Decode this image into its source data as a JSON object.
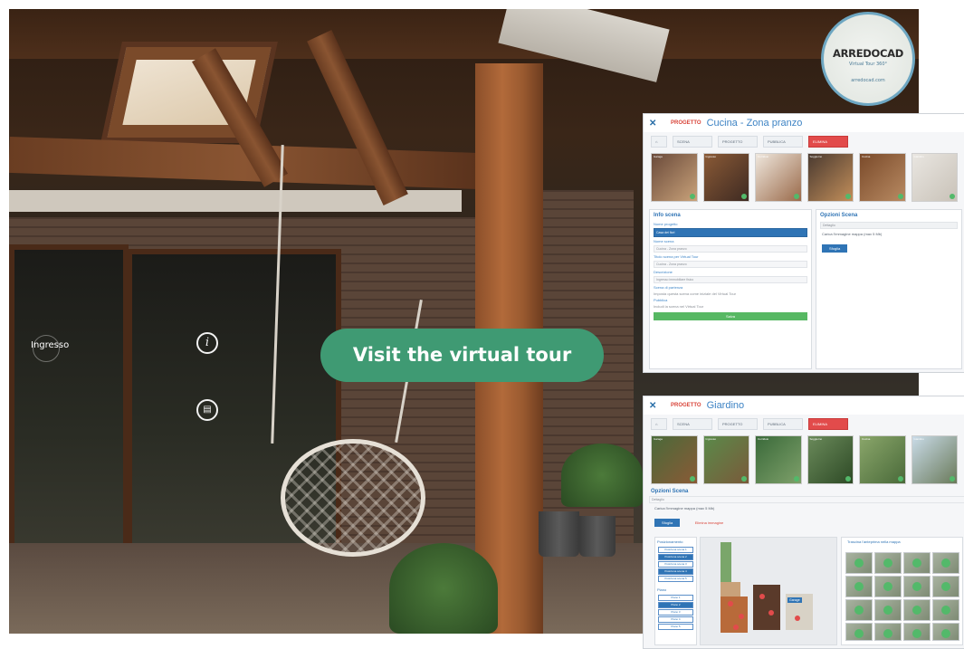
{
  "cta": {
    "label": "Visit the virtual tour"
  },
  "hotspot": {
    "entry_label": "Ingresso"
  },
  "icons": {
    "info": "info-icon",
    "document": "document-icon"
  },
  "logo": {
    "brand": "ARREDOCAD",
    "tagline": "Virtual Tour 360°",
    "site": "arredocad.com"
  },
  "colors": {
    "cta": "#3f9a73",
    "editor_accent": "#3d83c4",
    "tab_active": "#e24b4b",
    "ok": "#53b96a"
  },
  "editor_top": {
    "section_label": "PROGETTO",
    "title": "Cucina - Zona pranzo",
    "tabs": [
      "SCENA",
      "PROGETTO",
      "PUBBLICA",
      "ELIMINA"
    ],
    "thumbs": [
      "Garage",
      "Ingresso",
      "Corridoio",
      "Soggiorno",
      "Cucina",
      "Giardino"
    ],
    "info": {
      "heading": "Info scena",
      "fields": [
        {
          "label": "Nome progetto",
          "value": "Casa dei fiori"
        },
        {
          "label": "Nome scena",
          "value": "Cucina - Zona pranzo"
        },
        {
          "label": "Titolo scena per Virtual Tour",
          "value": "Cucina - Zona pranzo"
        },
        {
          "label": "Descrizione",
          "value": "Ingresso immobiliare fisico"
        }
      ],
      "initial_label": "Scena di partenza",
      "initial_check": "Imposta questa scena come iniziale del Virtual Tour",
      "publish_label": "Pubblica",
      "publish_check": "Includi la scena nel Virtual Tour",
      "save": "Salva"
    },
    "options": {
      "heading": "Opzioni Scena",
      "tab": "Dettaglio",
      "upload_text": "Carica l'immagine mappa (max 5 Mb)",
      "browse": "Sfoglia"
    }
  },
  "editor_bottom": {
    "section_label": "PROGETTO",
    "title": "Giardino",
    "tabs": [
      "SCENA",
      "PROGETTO",
      "PUBBLICA",
      "ELIMINA"
    ],
    "thumbs": [
      "Garage",
      "Ingresso",
      "Corridoio",
      "Soggiorno",
      "Cucina",
      "Giardino"
    ],
    "options": {
      "heading": "Opzioni Scena",
      "tab": "Dettaglio",
      "upload_text": "Carica l'immagine mappa (max 5 Mb)",
      "browse": "Sfoglia",
      "remove": "Elimina immagine",
      "positioning": "Posizionamento",
      "floor": "Piano",
      "drag_text": "Trascina l'anteprima nella mappa",
      "positions": [
        "Posiziona scena 1",
        "Posiziona scena 2",
        "Posiziona scena 3",
        "Posiziona scena 4",
        "Posiziona scena 5"
      ],
      "floors": [
        "Piano 1",
        "Piano 2",
        "Piano 3",
        "Piano 4",
        "Piano 5"
      ],
      "map_label": "Garage"
    }
  }
}
